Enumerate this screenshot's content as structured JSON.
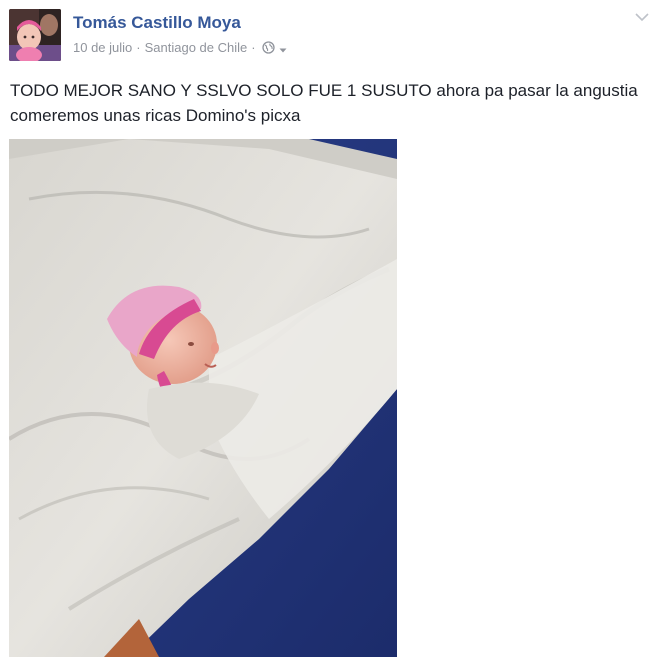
{
  "post": {
    "author_name": "Tomás Castillo Moya",
    "date": "10 de julio",
    "separator": "·",
    "location": "Santiago de Chile",
    "privacy_icon": "globe-icon",
    "caret_icon": "caret-down-icon",
    "options_icon": "chevron-down-icon",
    "text": "TODO MEJOR SANO Y SSLVO SOLO FUE 1 SUSUTO ahora pa pasar la angustia comeremos unas ricas Domino's picxa"
  },
  "colors": {
    "author_link": "#365899",
    "meta_text": "#90949c",
    "body_text": "#1d2129"
  }
}
